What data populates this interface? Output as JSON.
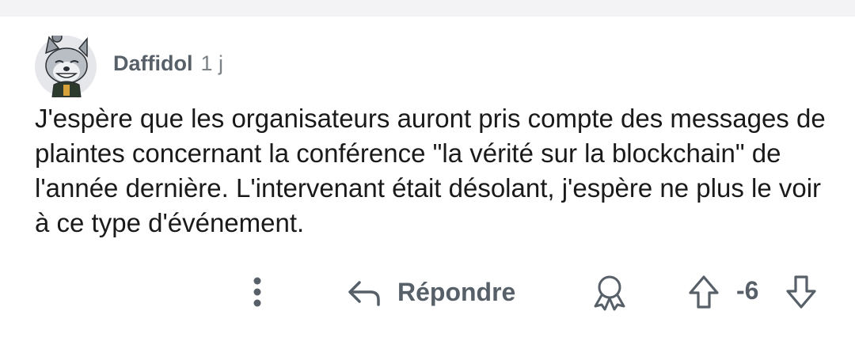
{
  "comment": {
    "author": "Daffidol",
    "age": "1 j",
    "text": "J'espère que les organisateurs auront pris compte des messages de plaintes concernant la conférence \"la vérité sur la blockchain\" de l'année dernière. L'intervenant était désolant, j'espère ne plus le voir à ce type d'événement.",
    "avatar_icon": "wolf-avatar-icon"
  },
  "actions": {
    "more_icon": "more-vertical-icon",
    "reply_icon": "reply-arrow-icon",
    "reply_label": "Répondre",
    "award_icon": "award-icon",
    "upvote_icon": "upvote-arrow-icon",
    "score": "-6",
    "downvote_icon": "downvote-arrow-icon"
  },
  "colors": {
    "text_primary": "#1a1a1b",
    "text_secondary": "#576068",
    "top_strip": "#f3f3f5"
  }
}
